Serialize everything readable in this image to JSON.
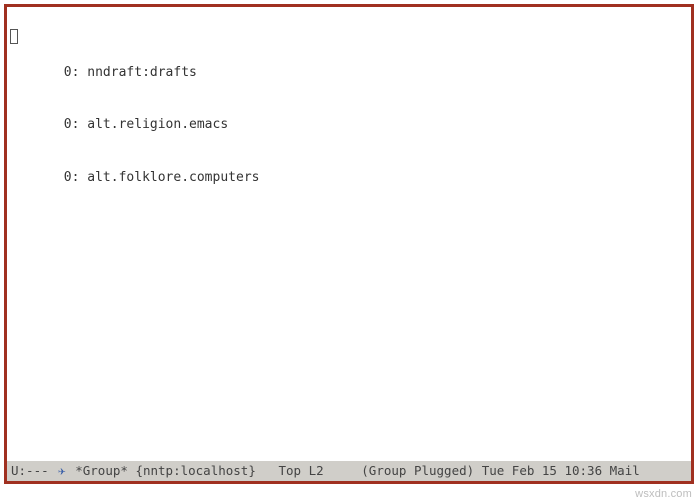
{
  "buffer": {
    "lines": [
      {
        "count": "0",
        "name": "nndraft:drafts"
      },
      {
        "count": "0",
        "name": "alt.religion.emacs"
      },
      {
        "count": "0",
        "name": "alt.folklore.computers"
      }
    ]
  },
  "modeline": {
    "status": "U:---",
    "icon_glyph": "✈",
    "buffer_name": "*Group*",
    "server": "{nntp:localhost}",
    "position": "Top",
    "line_col": "L2",
    "mode": "(Group Plugged)",
    "datetime": "Tue Feb 15 10:36",
    "extra": "Mail"
  },
  "watermark": "wsxdn.com"
}
